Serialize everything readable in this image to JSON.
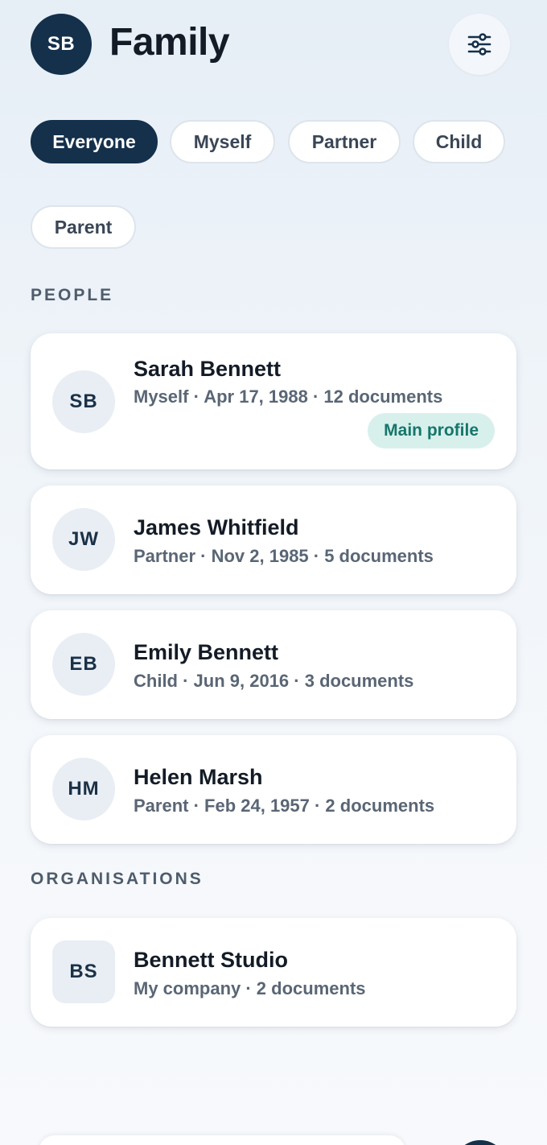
{
  "header": {
    "avatar_initials": "SB",
    "title": "Family",
    "filter_icon": "sliders-icon"
  },
  "filters": [
    {
      "label": "Everyone",
      "active": true
    },
    {
      "label": "Myself",
      "active": false
    },
    {
      "label": "Partner",
      "active": false
    },
    {
      "label": "Child",
      "active": false
    },
    {
      "label": "Parent",
      "active": false
    }
  ],
  "sections": {
    "people_label": "PEOPLE",
    "organisations_label": "ORGANISATIONS"
  },
  "people": [
    {
      "initials": "SB",
      "name": "Sarah Bennett",
      "meta": "Myself · Apr 17, 1988 · 12 documents",
      "badge": "Main profile"
    },
    {
      "initials": "JW",
      "name": "James Whitfield",
      "meta": "Partner · Nov 2, 1985 · 5 documents"
    },
    {
      "initials": "EB",
      "name": "Emily Bennett",
      "meta": "Child · Jun 9, 2016 · 3 documents"
    },
    {
      "initials": "HM",
      "name": "Helen Marsh",
      "meta": "Parent · Feb 24, 1957 · 2 documents"
    }
  ],
  "organisations": [
    {
      "initials": "BS",
      "name": "Bennett Studio",
      "meta": "My company · 2 documents"
    }
  ],
  "colors": {
    "primary": "#14304b",
    "badge_bg": "#d8f0ec",
    "badge_text": "#16766b"
  }
}
